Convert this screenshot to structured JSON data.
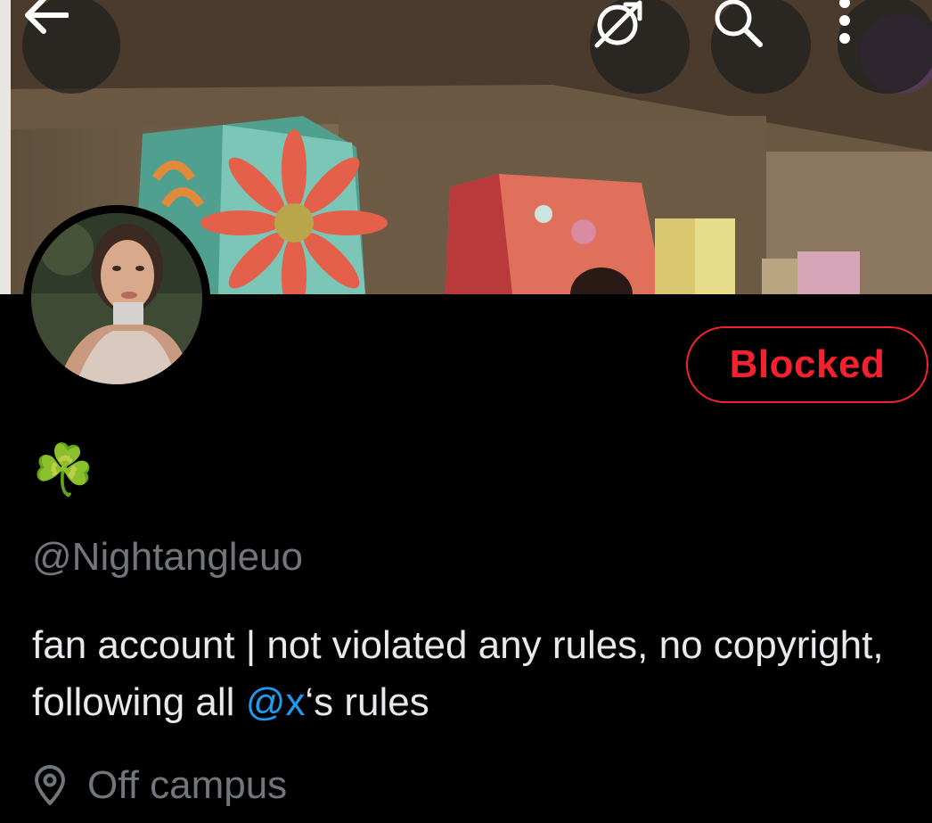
{
  "header": {
    "back_icon": "arrow-left-icon",
    "translate_icon": "translate-slash-icon",
    "search_icon": "search-icon",
    "more_icon": "more-vertical-icon"
  },
  "profile": {
    "display_name": "☘️",
    "handle": "@Nightangleuo",
    "bio_prefix": "fan account | not violated any rules, no copyright, following all ",
    "bio_mention": "@x",
    "bio_suffix": "‘s rules",
    "location": "Off campus",
    "location_icon": "location-pin-icon"
  },
  "actions": {
    "blocked_label": "Blocked"
  },
  "colors": {
    "background": "#000000",
    "text_primary": "#e7e9ea",
    "text_secondary": "#71767b",
    "mention": "#1d9bf0",
    "blocked": "#f4212e"
  }
}
